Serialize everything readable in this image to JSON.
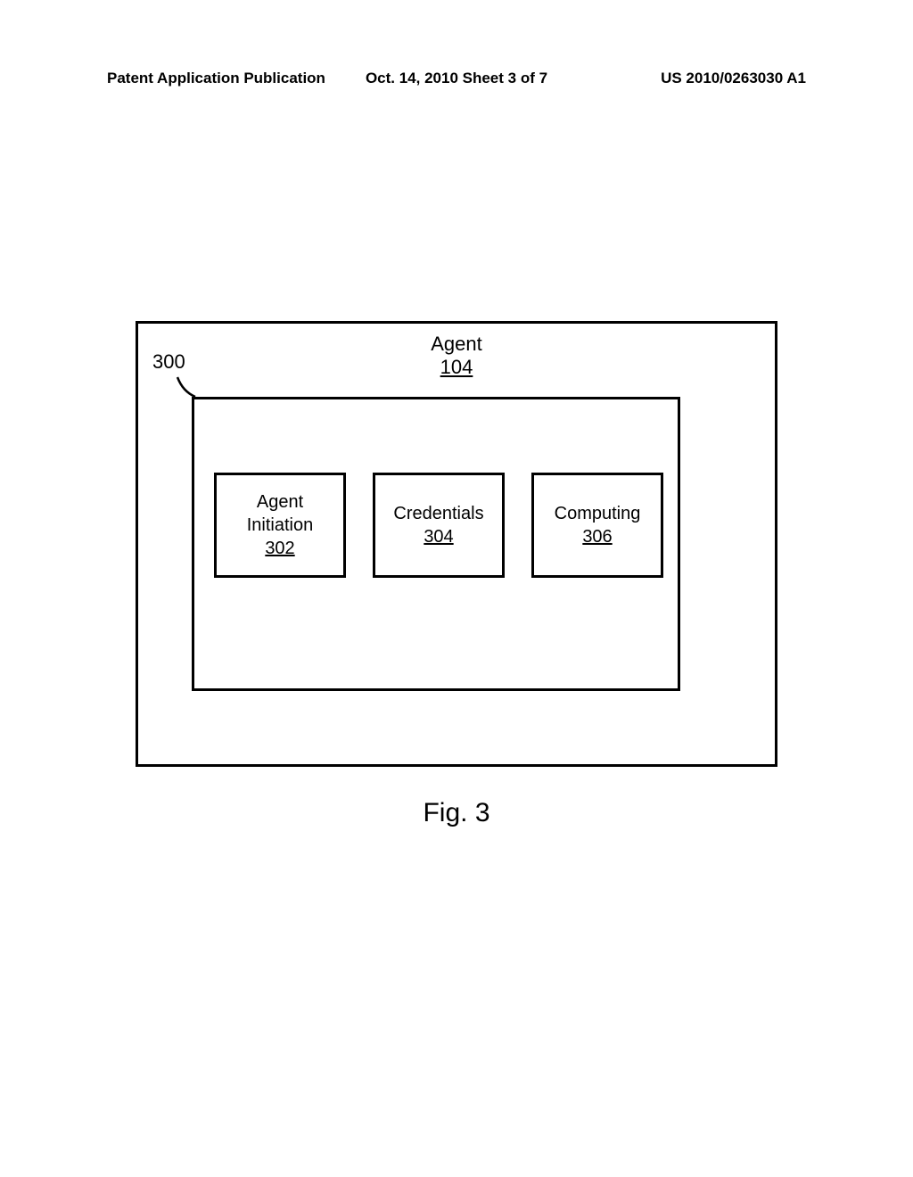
{
  "header": {
    "left": "Patent Application Publication",
    "center": "Oct. 14, 2010  Sheet 3 of 7",
    "right": "US 2010/0263030 A1"
  },
  "figure": {
    "outer_ref": "300",
    "agent": {
      "label": "Agent",
      "ref": "104"
    },
    "boxes": {
      "box1": {
        "line1": "Agent",
        "line2": "Initiation",
        "ref": "302"
      },
      "box2": {
        "line1": "Credentials",
        "ref": "304"
      },
      "box3": {
        "line1": "Computing",
        "ref": "306"
      }
    },
    "caption": "Fig. 3"
  }
}
